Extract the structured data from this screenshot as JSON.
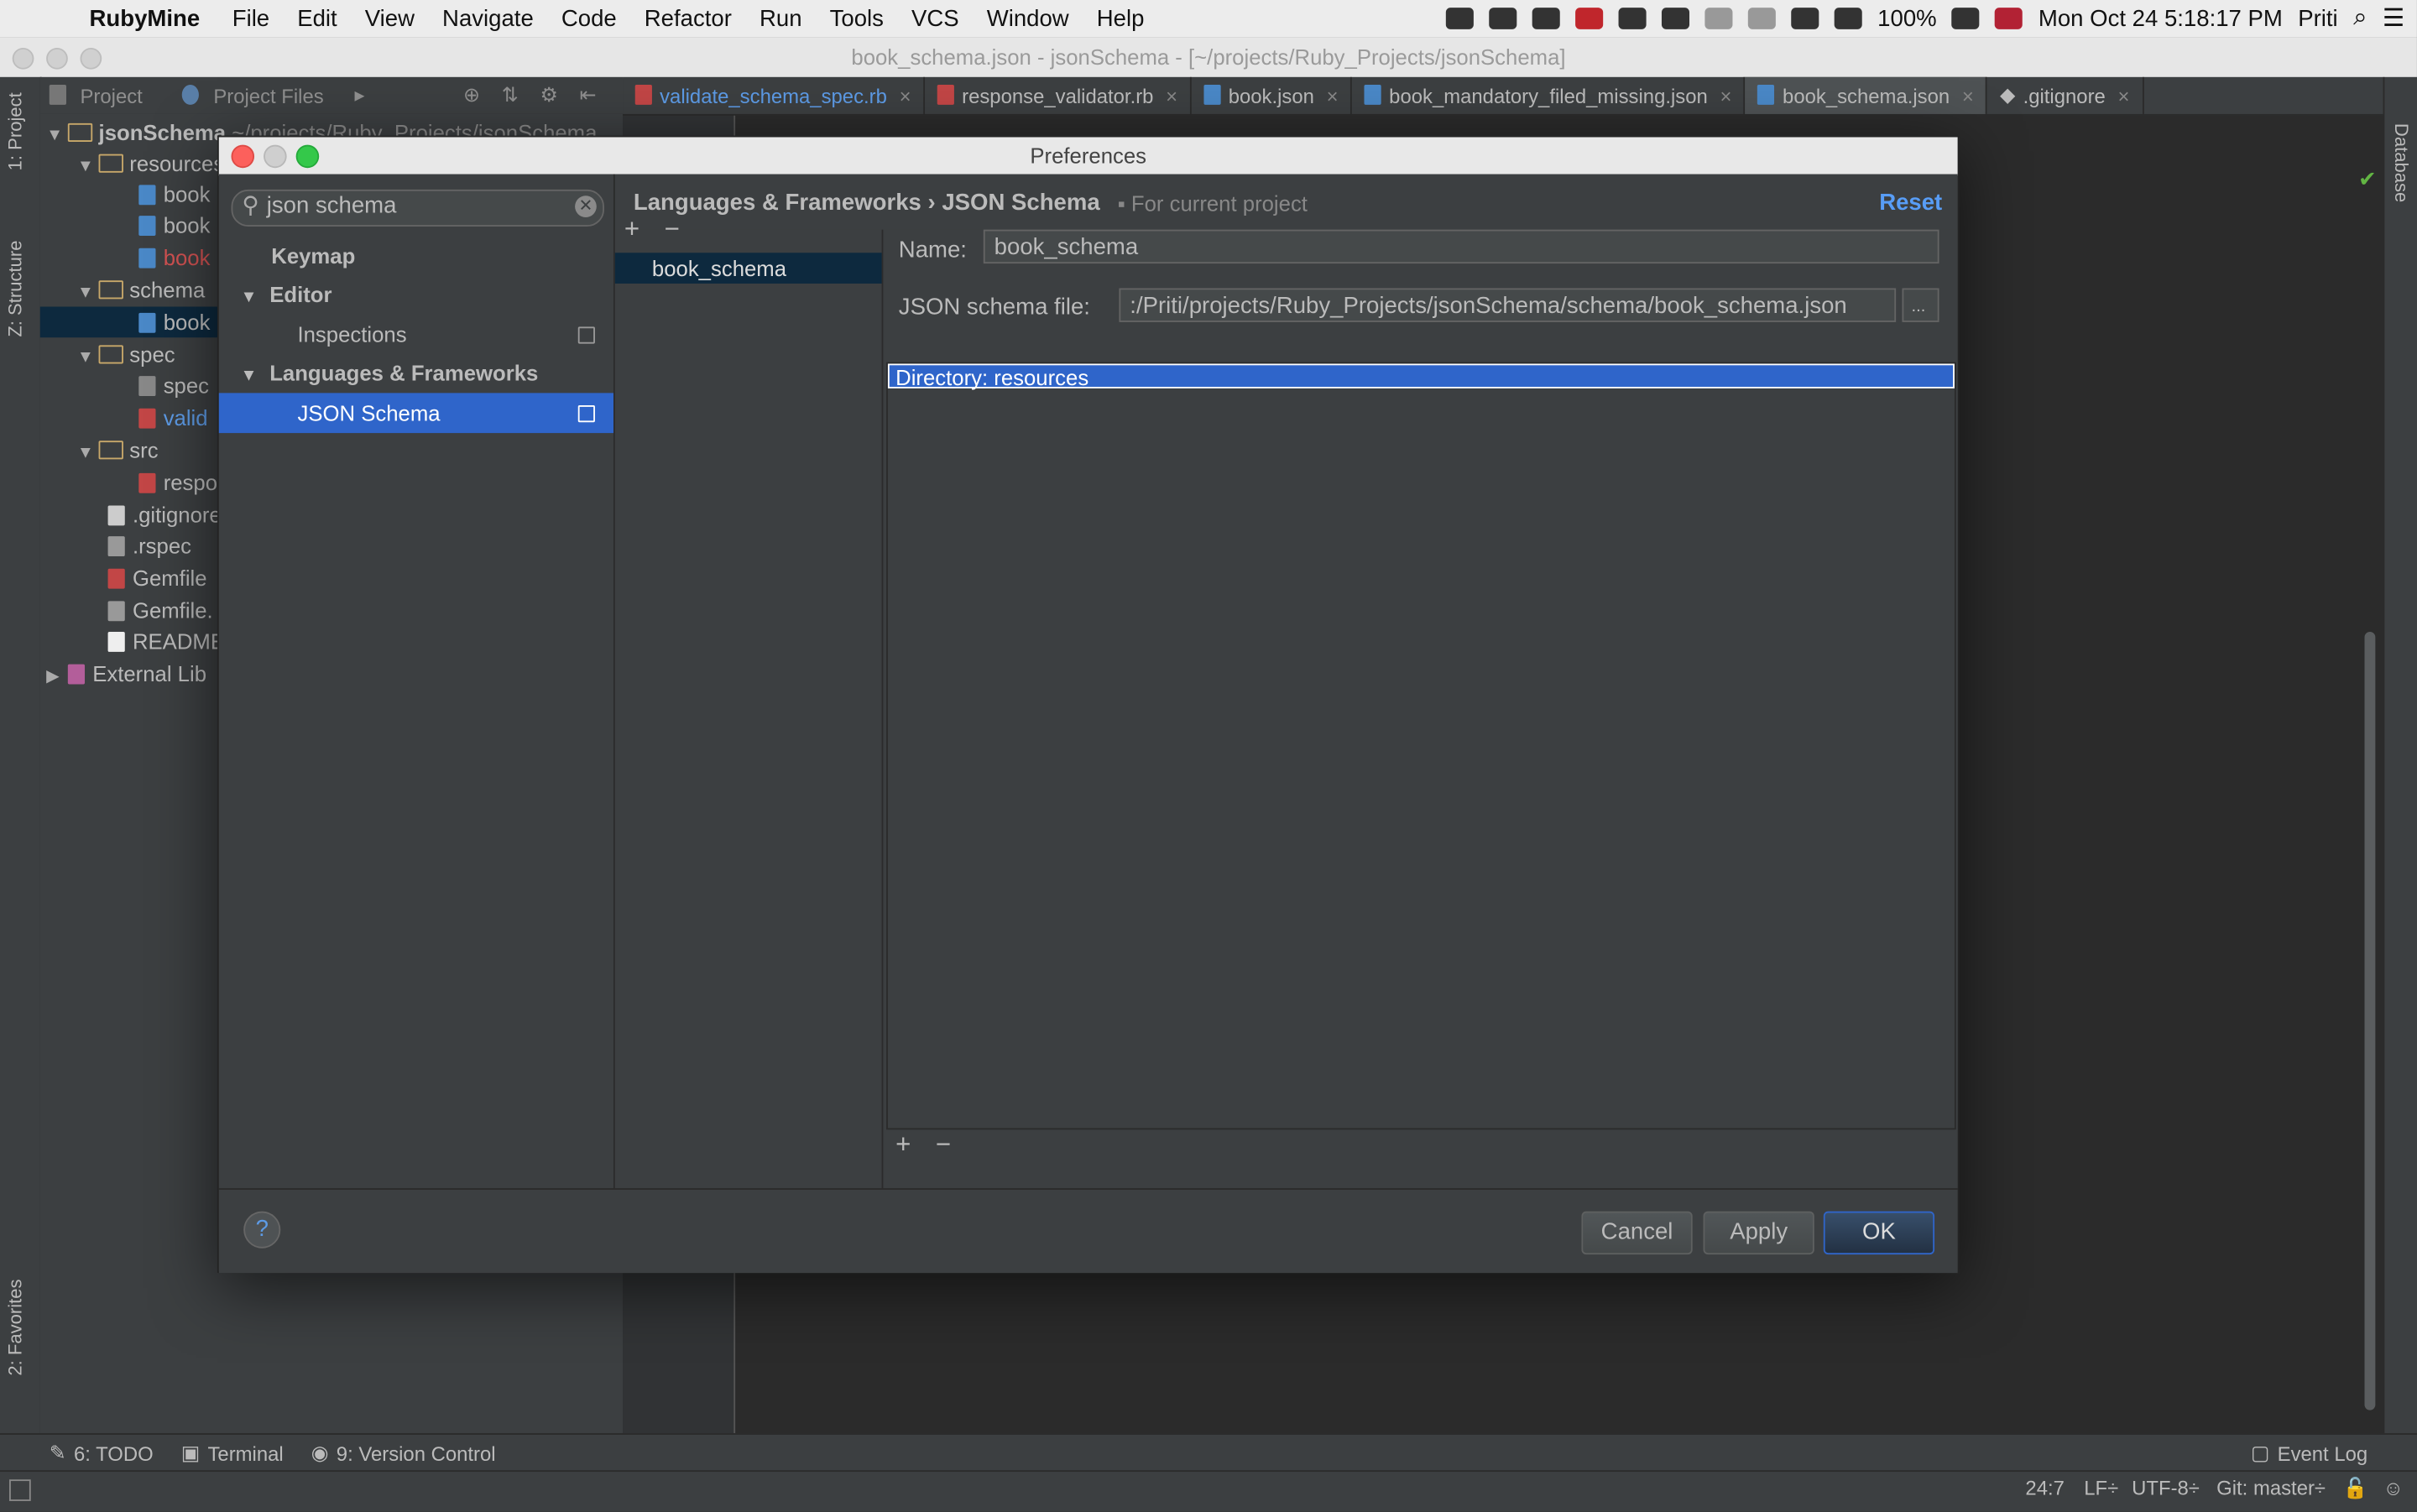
{
  "menubar": {
    "app_name": "RubyMine",
    "menus": [
      "File",
      "Edit",
      "View",
      "Navigate",
      "Code",
      "Refactor",
      "Run",
      "Tools",
      "VCS",
      "Window",
      "Help"
    ],
    "battery": "100%",
    "datetime": "Mon Oct 24  5:18:17 PM",
    "user": "Priti"
  },
  "window": {
    "title": "book_schema.json - jsonSchema - [~/projects/Ruby_Projects/jsonSchema]"
  },
  "project_toolbar": {
    "project_label": "Project",
    "files_label": "Project Files"
  },
  "stripes": {
    "project": "1: Project",
    "structure": "Z: Structure",
    "favorites": "2: Favorites",
    "database": "Database"
  },
  "tree": {
    "root_label": "jsonSchema",
    "root_path": "~/projects/Ruby_Projects/jsonSchema",
    "rows": [
      {
        "label": "resources"
      },
      {
        "label": "book"
      },
      {
        "label": "book"
      },
      {
        "label": "book"
      },
      {
        "label": "schema"
      },
      {
        "label": "book"
      },
      {
        "label": "spec"
      },
      {
        "label": "spec"
      },
      {
        "label": "valid"
      },
      {
        "label": "src"
      },
      {
        "label": "respo"
      },
      {
        "label": ".gitignore"
      },
      {
        "label": ".rspec"
      },
      {
        "label": "Gemfile"
      },
      {
        "label": "Gemfile."
      },
      {
        "label": "README"
      },
      {
        "label": "External Lib"
      }
    ]
  },
  "editor_tabs": [
    {
      "label": "validate_schema_spec.rb"
    },
    {
      "label": "response_validator.rb"
    },
    {
      "label": "book.json"
    },
    {
      "label": "book_mandatory_filed_missing.json"
    },
    {
      "label": "book_schema.json"
    },
    {
      "label": ".gitignore"
    }
  ],
  "bottom_tools": {
    "todo": "6: TODO",
    "terminal": "Terminal",
    "vcs": "9: Version Control",
    "event_log": "Event Log"
  },
  "status": {
    "position": "24:7",
    "line_sep": "LF÷",
    "encoding": "UTF-8÷",
    "git": "Git: master÷"
  },
  "dialog": {
    "title": "Preferences",
    "search_value": "json schema",
    "categories": [
      {
        "label": "Keymap"
      },
      {
        "label": "Editor"
      },
      {
        "label": "Inspections"
      },
      {
        "label": "Languages & Frameworks"
      },
      {
        "label": "JSON Schema"
      }
    ],
    "breadcrumb": "Languages & Frameworks › JSON Schema",
    "for_project": "For current project",
    "reset_label": "Reset",
    "schemas": [
      "book_schema"
    ],
    "name_label": "Name:",
    "name_value": "book_schema",
    "file_label": "JSON schema file:",
    "file_value": ":/Priti/projects/Ruby_Projects/jsonSchema/schema/book_schema.json",
    "browse_label": "...",
    "mapping_selected": "Directory: resources",
    "help_label": "?",
    "cancel_label": "Cancel",
    "apply_label": "Apply",
    "ok_label": "OK"
  }
}
